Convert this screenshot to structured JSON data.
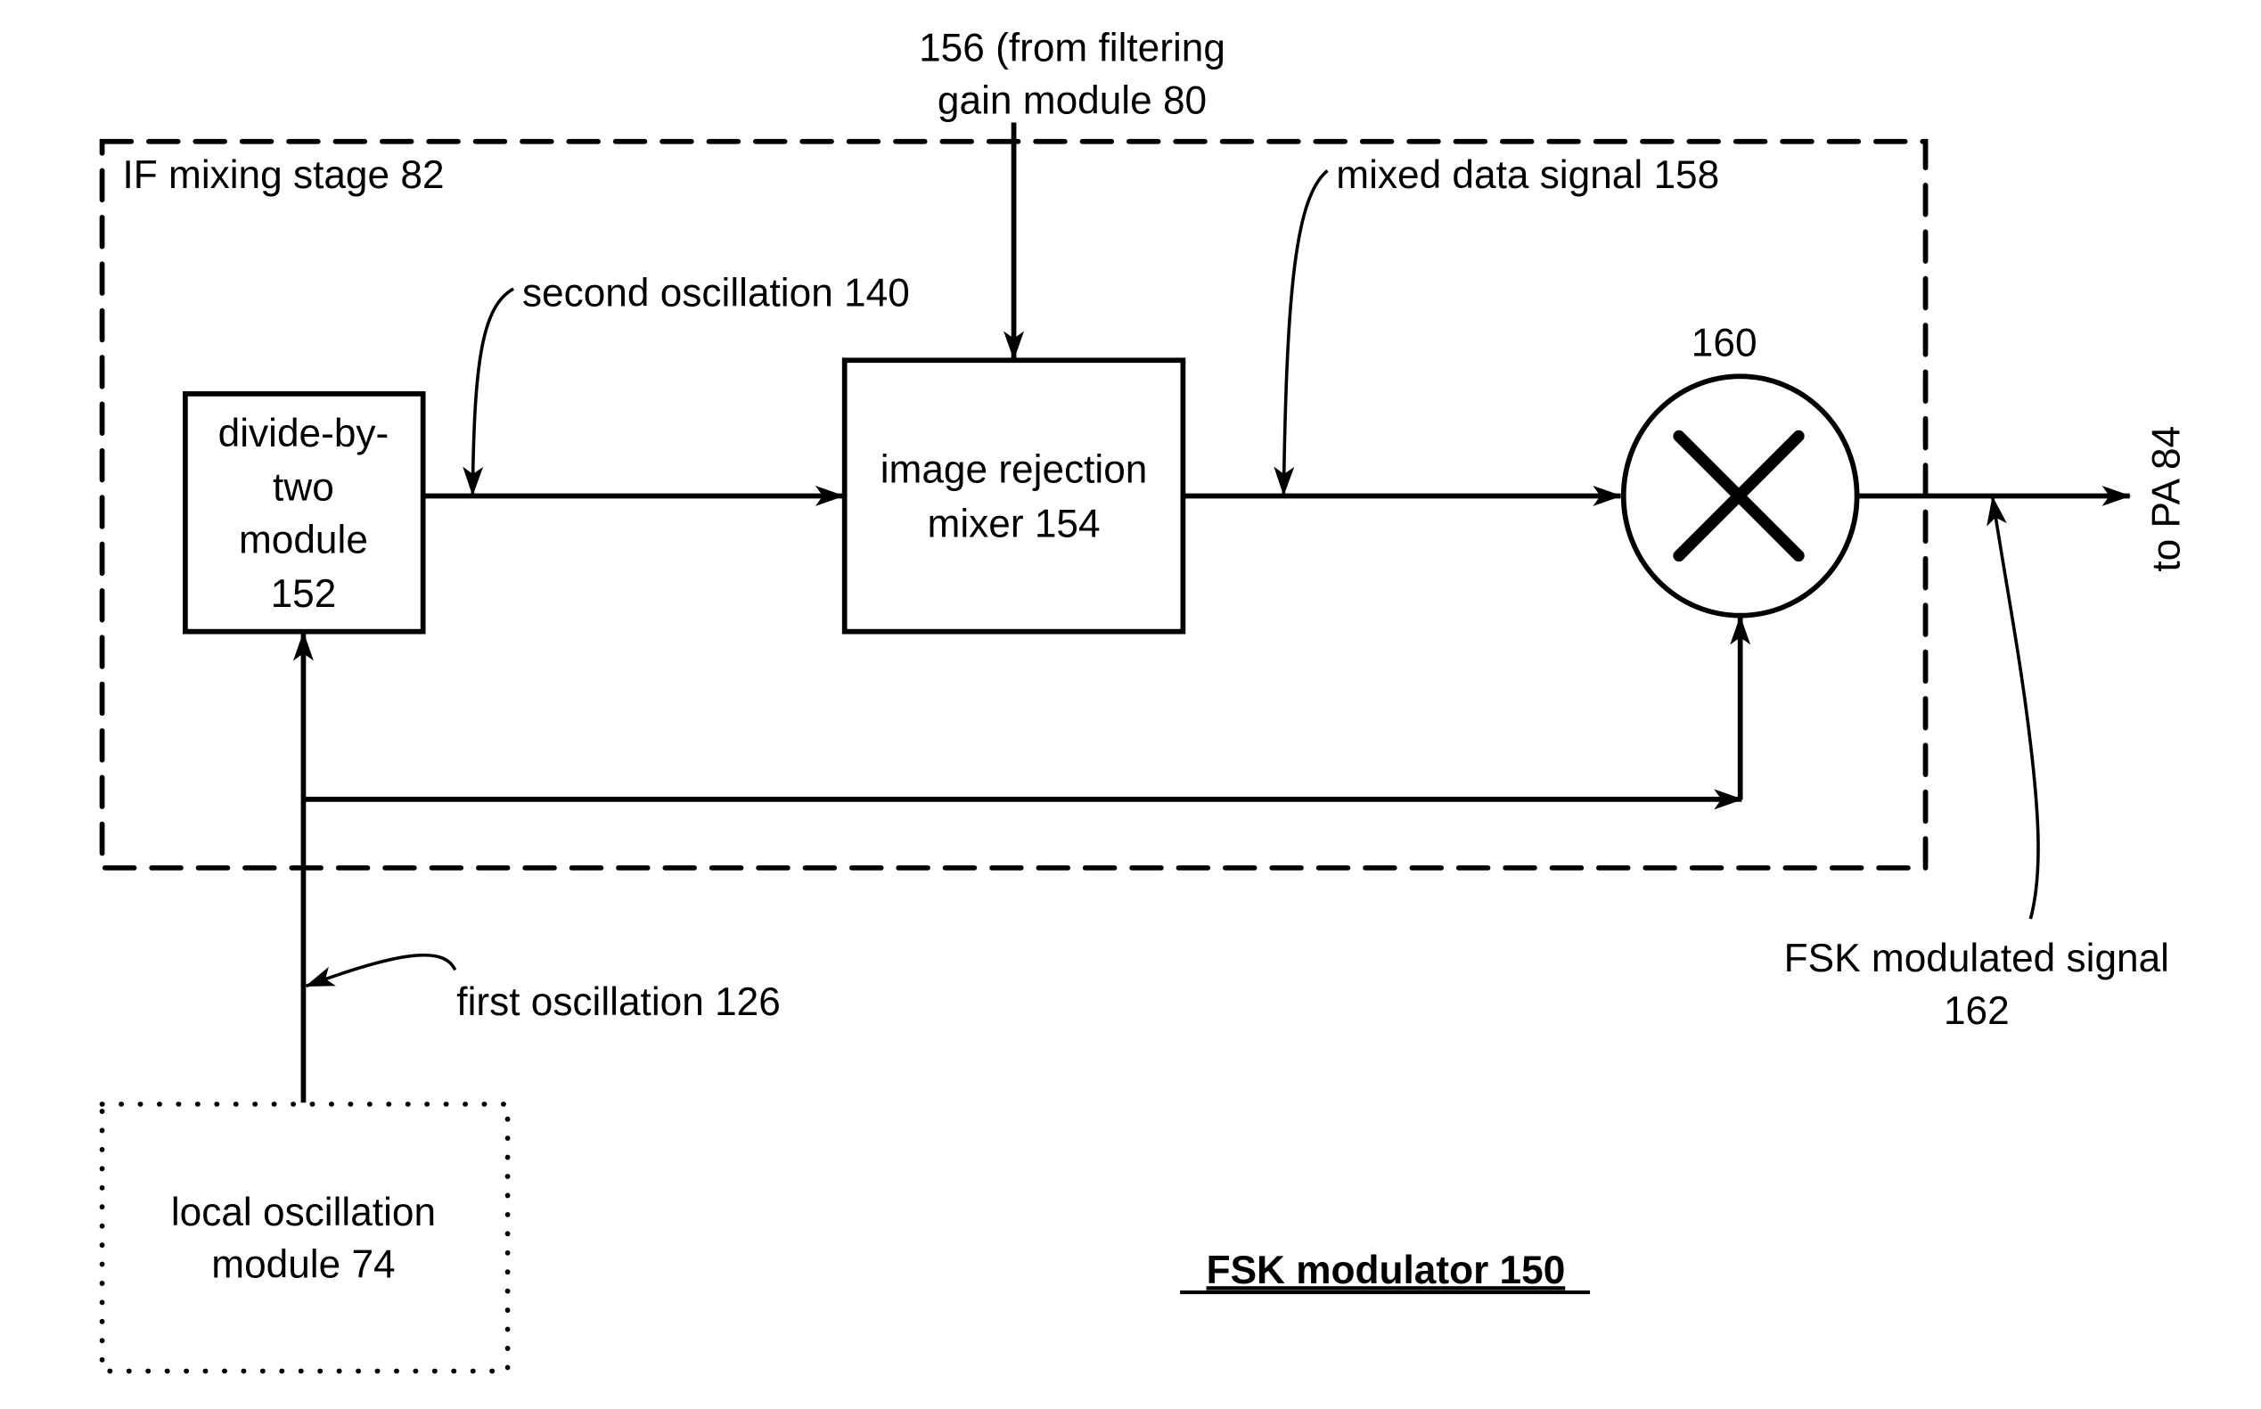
{
  "figure": {
    "title": "FSK modulator 150",
    "background": "#ffffff",
    "ink": "#000000"
  },
  "stage": {
    "label": "IF mixing stage 82"
  },
  "blocks": {
    "divider": {
      "lines": [
        "divide-by-",
        "two",
        "module",
        "152"
      ]
    },
    "irm": {
      "lines": [
        "image rejection",
        "mixer 154"
      ]
    },
    "multiplier": {
      "label": "160",
      "symbol": "multiply-icon"
    },
    "lo": {
      "lines": [
        "local oscillation",
        "module 74"
      ]
    }
  },
  "signals": {
    "input156": [
      "156 (from filtering",
      "gain module 80"
    ],
    "second_osc": "second oscillation 140",
    "mixed": "mixed data signal 158",
    "first_osc": "first oscillation 126",
    "fsk_out": [
      "FSK modulated signal",
      "162"
    ],
    "to_pa": "to PA 84"
  }
}
